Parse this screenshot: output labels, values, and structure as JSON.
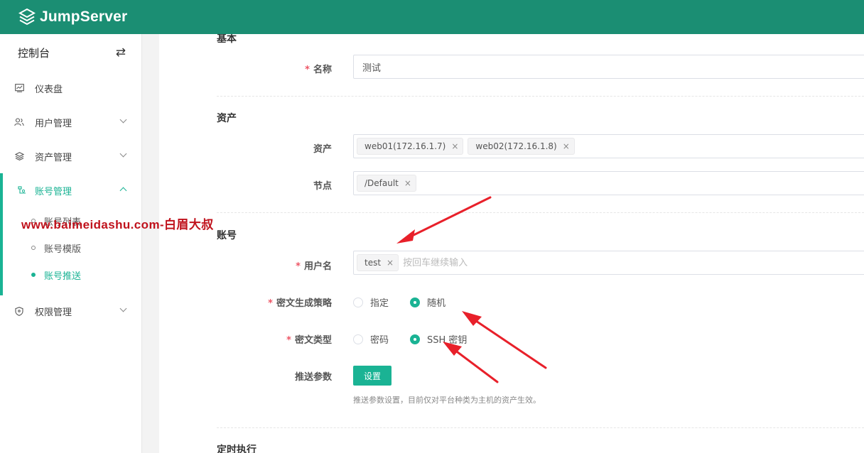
{
  "app": {
    "brand": "JumpServer"
  },
  "sidebar": {
    "console_label": "控制台",
    "switch_icon": "⇄",
    "items": [
      {
        "label": "仪表盘",
        "icon": "dashboard-icon"
      },
      {
        "label": "用户管理",
        "icon": "users-icon"
      },
      {
        "label": "资产管理",
        "icon": "assets-icon"
      },
      {
        "label": "账号管理",
        "icon": "account-icon",
        "active": true,
        "children": [
          {
            "label": "账号列表"
          },
          {
            "label": "账号模版"
          },
          {
            "label": "账号推送",
            "active": true
          }
        ]
      },
      {
        "label": "权限管理",
        "icon": "shield-icon"
      }
    ]
  },
  "form": {
    "basic": {
      "title": "基本",
      "name_label": "名称",
      "name_value": "测试"
    },
    "asset": {
      "title": "资产",
      "assets_label": "资产",
      "assets": [
        "web01(172.16.1.7)",
        "web02(172.16.1.8)"
      ],
      "nodes_label": "节点",
      "nodes": [
        "/Default"
      ]
    },
    "account": {
      "title": "账号",
      "username_label": "用户名",
      "usernames": [
        "test"
      ],
      "username_placeholder": "按回车继续输入",
      "secret_strategy_label": "密文生成策略",
      "secret_strategy_options": [
        "指定",
        "随机"
      ],
      "secret_strategy_selected": "随机",
      "secret_type_label": "密文类型",
      "secret_type_options": [
        "密码",
        "SSH 密钥"
      ],
      "secret_type_selected": "SSH 密钥",
      "push_params_label": "推送参数",
      "push_params_button": "设置",
      "push_params_help": "推送参数设置，目前仅对平台种类为主机的资产生效。"
    },
    "schedule": {
      "title": "定时执行"
    }
  },
  "watermark": "www.baimeidashu.com-白眉大叔",
  "colors": {
    "topbar": "#1b8e73",
    "primary": "#1ab394",
    "required": "#ed5565",
    "annotation": "#e8202a"
  }
}
